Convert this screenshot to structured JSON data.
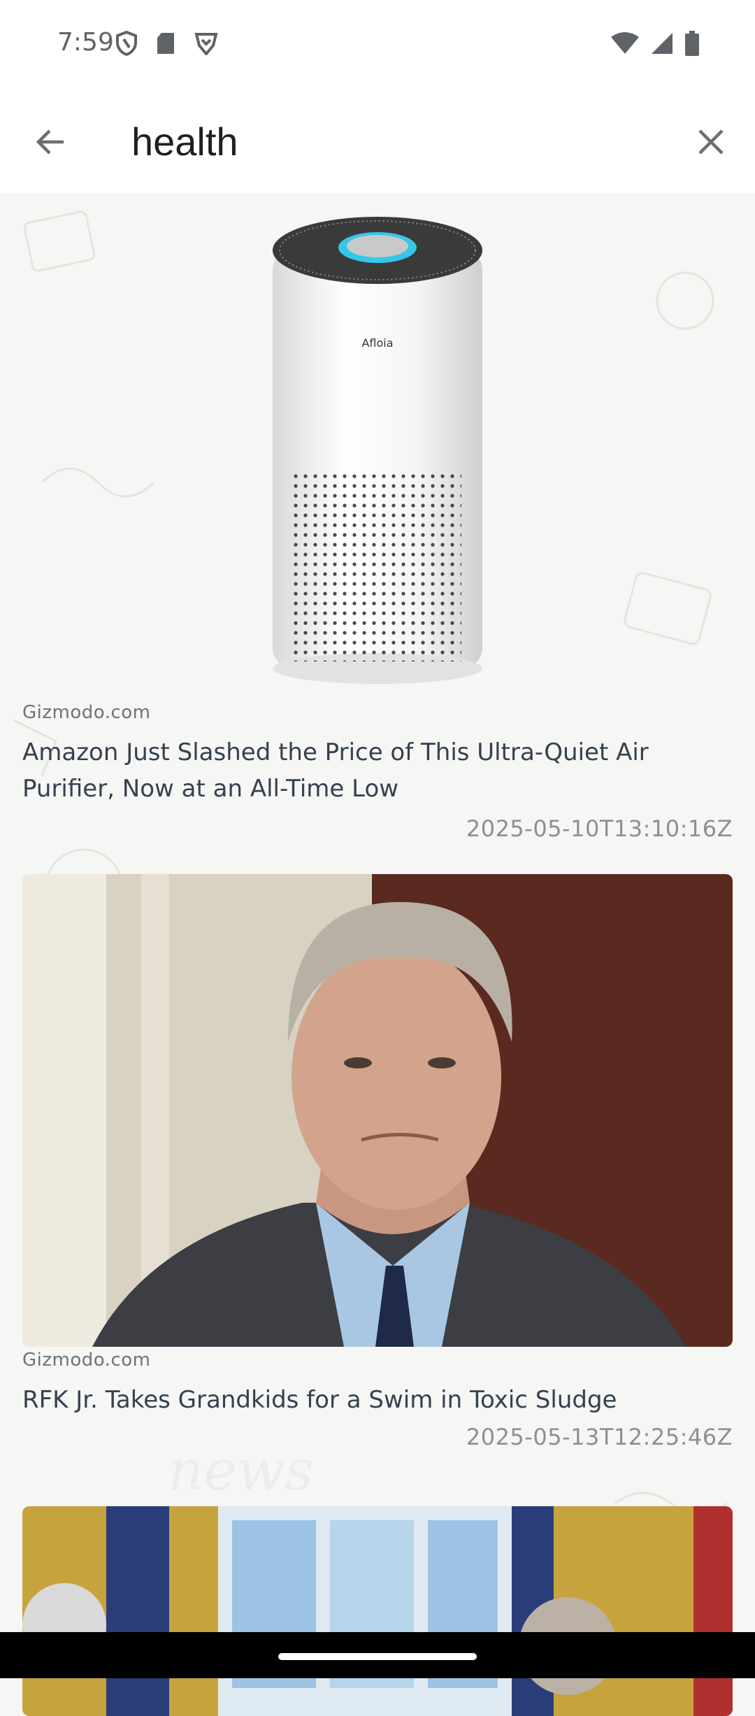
{
  "status_bar": {
    "time": "7:59",
    "left_icons": [
      "vpn-shield-icon",
      "sd-card-icon",
      "brave-icon"
    ],
    "right_icons": [
      "wifi-icon",
      "signal-icon",
      "battery-icon"
    ]
  },
  "search": {
    "query": "health",
    "back_icon": "arrow-left-icon",
    "clear_icon": "close-icon"
  },
  "articles": [
    {
      "image": "air-purifier-image",
      "source": "Gizmodo.com",
      "title": "Amazon Just Slashed the Price of This Ultra-Quiet Air Purifier, Now at an All-Time Low",
      "date": "2025-05-10T13:10:16Z",
      "product_brand": "Afloia"
    },
    {
      "image": "rfk-portrait-image",
      "source": "Gizmodo.com",
      "title": "RFK Jr. Takes Grandkids for a Swim in Toxic Sludge",
      "date": "2025-05-13T12:25:46Z"
    },
    {
      "image": "oval-office-image"
    }
  ],
  "colors": {
    "background": "#f6f6f4",
    "title_text": "#34414f",
    "meta_text": "#8a9096",
    "purifier_ring": "#35c7ea"
  }
}
